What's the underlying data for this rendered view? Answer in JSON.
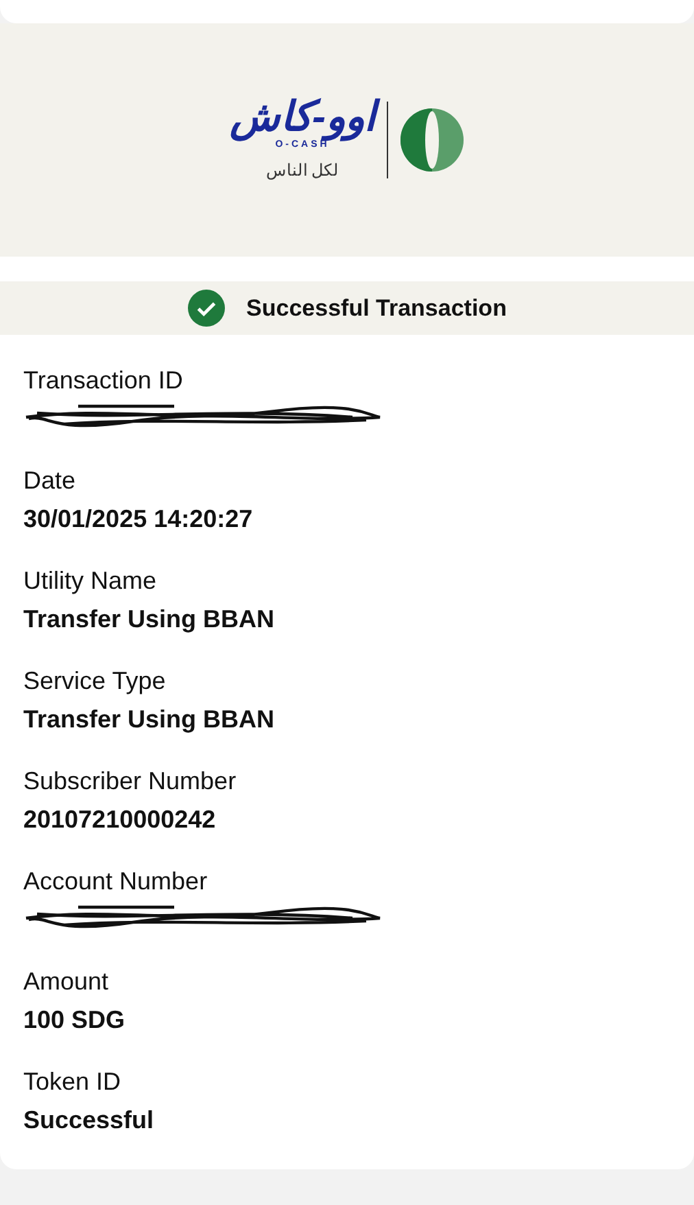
{
  "logo": {
    "wordmark": "اوو-كاش",
    "sub_wordmark": "O-CASH",
    "tagline": "لكل الناس"
  },
  "status": {
    "text": "Successful Transaction",
    "success": true
  },
  "fields": [
    {
      "label": "Transaction ID",
      "redacted": true
    },
    {
      "label": "Date",
      "value": "30/01/2025 14:20:27"
    },
    {
      "label": "Utility Name",
      "value": "Transfer Using BBAN"
    },
    {
      "label": "Service Type",
      "value": "Transfer Using BBAN"
    },
    {
      "label": "Subscriber Number",
      "value": "20107210000242"
    },
    {
      "label": "Account Number",
      "redacted": true
    },
    {
      "label": "Amount",
      "value": "100 SDG"
    },
    {
      "label": "Token ID",
      "value": "Successful"
    }
  ]
}
